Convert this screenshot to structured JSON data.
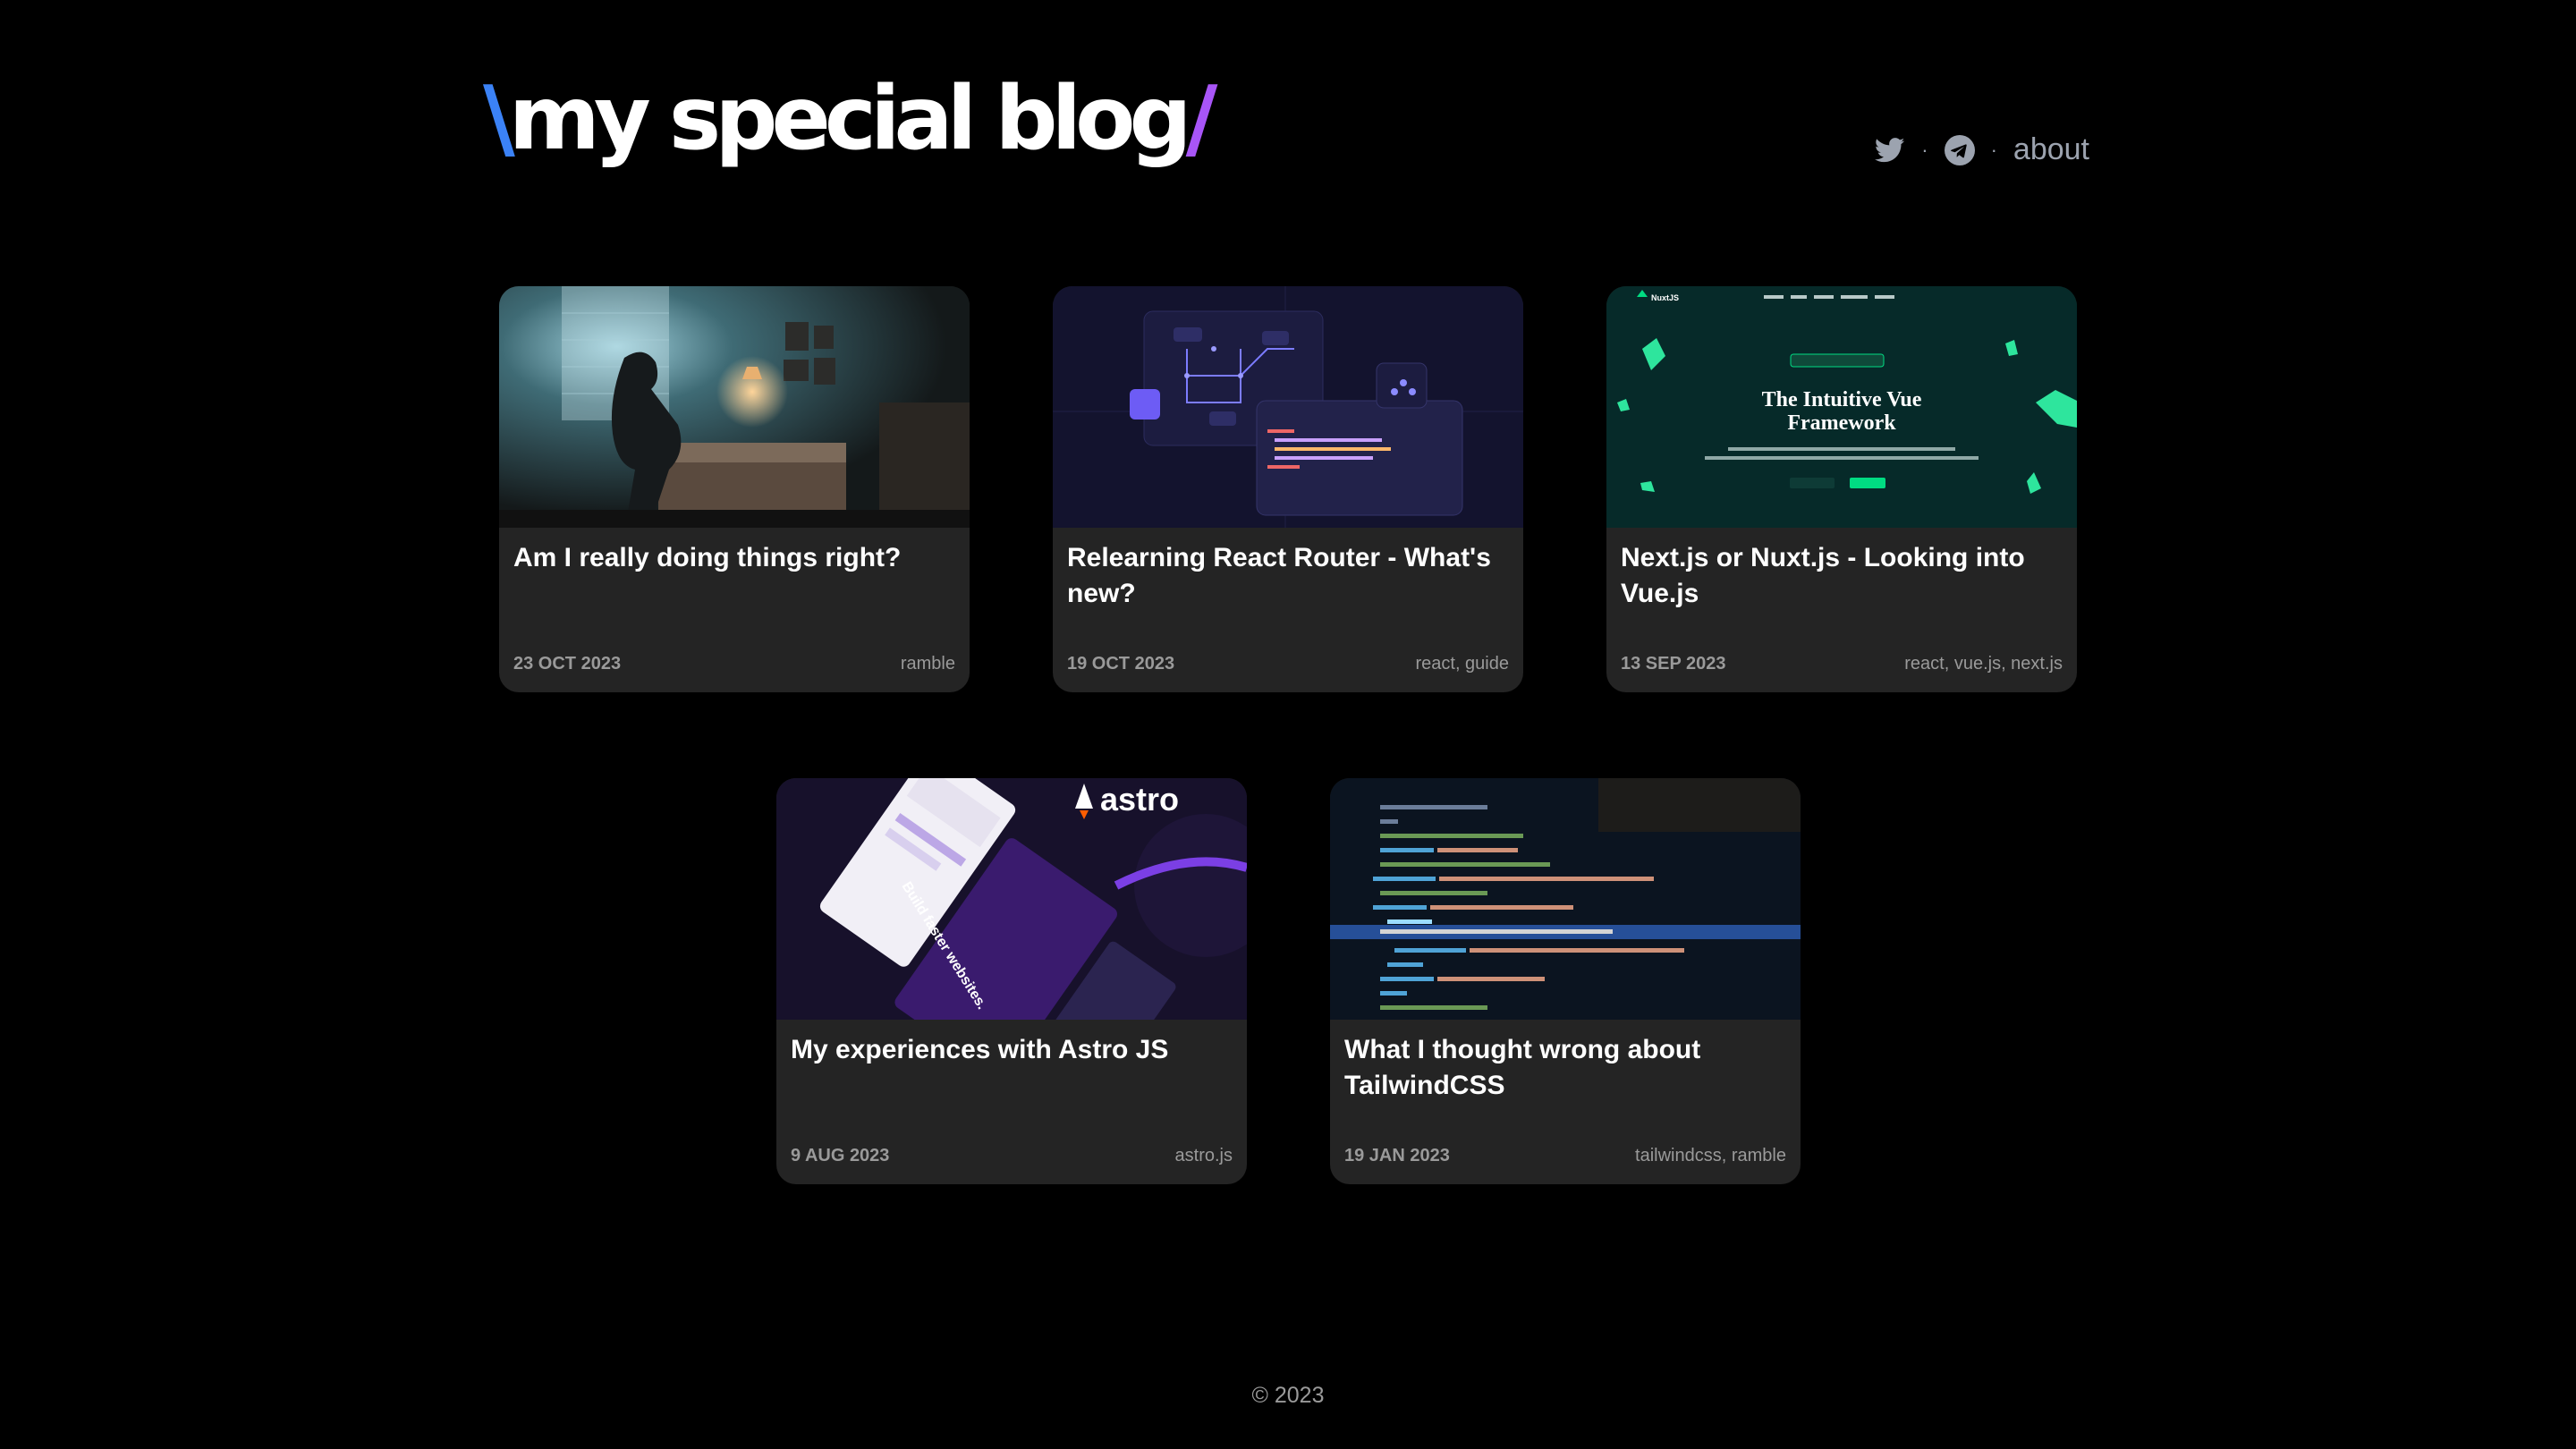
{
  "header": {
    "logo_slash_left": "\\",
    "logo_text": "my special blog",
    "logo_slash_right": "/",
    "nav": {
      "twitter_icon": "twitter-icon",
      "telegram_icon": "telegram-icon",
      "separator": "·",
      "about_label": "about"
    }
  },
  "posts": [
    {
      "title": "Am I really doing things right?",
      "date": "23 OCT 2023",
      "tags": "ramble",
      "image": "person-sitting-on-bed"
    },
    {
      "title": "Relearning React Router - What's new?",
      "date": "19 OCT 2023",
      "tags": "react, guide",
      "image": "react-router-diagram"
    },
    {
      "title": "Next.js or Nuxt.js - Looking into Vue.js",
      "date": "13 SEP 2023",
      "tags": "react, vue.js, next.js",
      "image": "nuxt-homepage",
      "thumb": {
        "brand": "NuxtJS",
        "headline_1": "The Intuitive Vue",
        "headline_2": "Framework"
      }
    },
    {
      "title": "My experiences with Astro JS",
      "date": "9 AUG 2023",
      "tags": "astro.js",
      "image": "astro-banner",
      "thumb": {
        "brand": "astro",
        "tagline": "Build faster websites."
      }
    },
    {
      "title": "What I thought wrong about TailwindCSS",
      "date": "19 JAN 2023",
      "tags": "tailwindcss, ramble",
      "image": "code-editor"
    }
  ],
  "footer": {
    "copyright": "© 2023"
  },
  "colors": {
    "background": "#000000",
    "card": "#242424",
    "slash_left": "#3b82f6",
    "slash_right": "#a855f7",
    "muted": "#9a9a9a"
  }
}
